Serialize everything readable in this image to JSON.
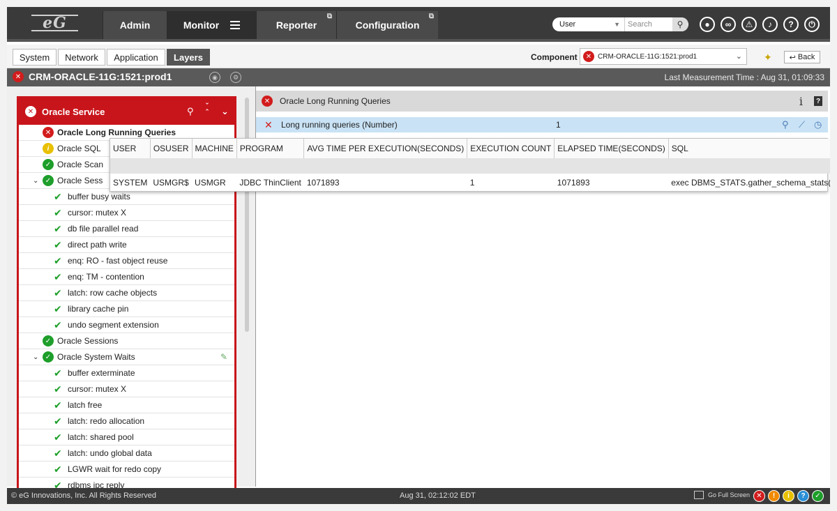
{
  "nav": {
    "tabs": [
      {
        "label": "Admin"
      },
      {
        "label": "Monitor"
      },
      {
        "label": "Reporter"
      },
      {
        "label": "Configuration"
      }
    ],
    "user_select": "User",
    "search_placeholder": "Search"
  },
  "layers": {
    "tabs": [
      "System",
      "Network",
      "Application",
      "Layers"
    ],
    "active": "Layers",
    "component_label": "Component",
    "component_value": "CRM-ORACLE-11G:1521:prod1",
    "back_label": "Back"
  },
  "strip": {
    "component_title": "CRM-ORACLE-11G:1521:prod1",
    "last_measurement": "Last Measurement Time : Aug 31, 01:09:33"
  },
  "tree": {
    "header": "Oracle Service",
    "rows": [
      {
        "label": "Oracle Long Running Queries",
        "status": "err",
        "level": 0,
        "bold": true
      },
      {
        "label": "Oracle SQL",
        "status": "warn",
        "level": 0
      },
      {
        "label": "Oracle Scan",
        "status": "ok",
        "level": 0
      },
      {
        "label": "Oracle Sess",
        "status": "ok",
        "level": 0,
        "expanded": true
      },
      {
        "label": "buffer busy waits",
        "status": "check",
        "level": 1
      },
      {
        "label": "cursor: mutex X",
        "status": "check",
        "level": 1
      },
      {
        "label": "db file parallel read",
        "status": "check",
        "level": 1
      },
      {
        "label": "direct path write",
        "status": "check",
        "level": 1
      },
      {
        "label": "enq: RO - fast object reuse",
        "status": "check",
        "level": 1
      },
      {
        "label": "enq: TM - contention",
        "status": "check",
        "level": 1
      },
      {
        "label": "latch: row cache objects",
        "status": "check",
        "level": 1
      },
      {
        "label": "library cache pin",
        "status": "check",
        "level": 1
      },
      {
        "label": "undo segment extension",
        "status": "check",
        "level": 1
      },
      {
        "label": "Oracle Sessions",
        "status": "ok",
        "level": 0
      },
      {
        "label": "Oracle System Waits",
        "status": "ok",
        "level": 0,
        "expanded": true
      },
      {
        "label": "buffer exterminate",
        "status": "check",
        "level": 1
      },
      {
        "label": "cursor: mutex X",
        "status": "check",
        "level": 1
      },
      {
        "label": "latch free",
        "status": "check",
        "level": 1
      },
      {
        "label": "latch: redo allocation",
        "status": "check",
        "level": 1
      },
      {
        "label": "latch: shared pool",
        "status": "check",
        "level": 1
      },
      {
        "label": "latch: undo global data",
        "status": "check",
        "level": 1
      },
      {
        "label": "LGWR wait for redo copy",
        "status": "check",
        "level": 1
      },
      {
        "label": "rdbms ipc reply",
        "status": "check",
        "level": 1
      }
    ]
  },
  "test": {
    "title": "Oracle Long Running Queries",
    "measure_label": "Long running queries (Number)",
    "measure_value": "1"
  },
  "detail": {
    "columns": [
      "USER",
      "OSUSER",
      "MACHINE",
      "PROGRAM",
      "AVG TIME PER EXECUTION(SECONDS)",
      "EXECUTION COUNT",
      "ELAPSED TIME(SECONDS)",
      "SQL"
    ],
    "rows": [
      [
        "SYSTEM",
        "USMGR$",
        "USMGR",
        "JDBC ThinClient",
        "1071893",
        "1",
        "1071893",
        "exec DBMS_STATS.gather_schema_stats(`kevin');"
      ]
    ]
  },
  "footer": {
    "copyright": "© eG Innovations, Inc. All Rights Reserved",
    "time": "Aug 31,  02:12:02 EDT",
    "fullscreen": "Go Full Screen"
  },
  "colors": {
    "critical": "#d21c1c",
    "major": "#f08a00",
    "minor": "#e8c000",
    "unknown": "#2a8fd6",
    "normal": "#1e9e2a"
  }
}
